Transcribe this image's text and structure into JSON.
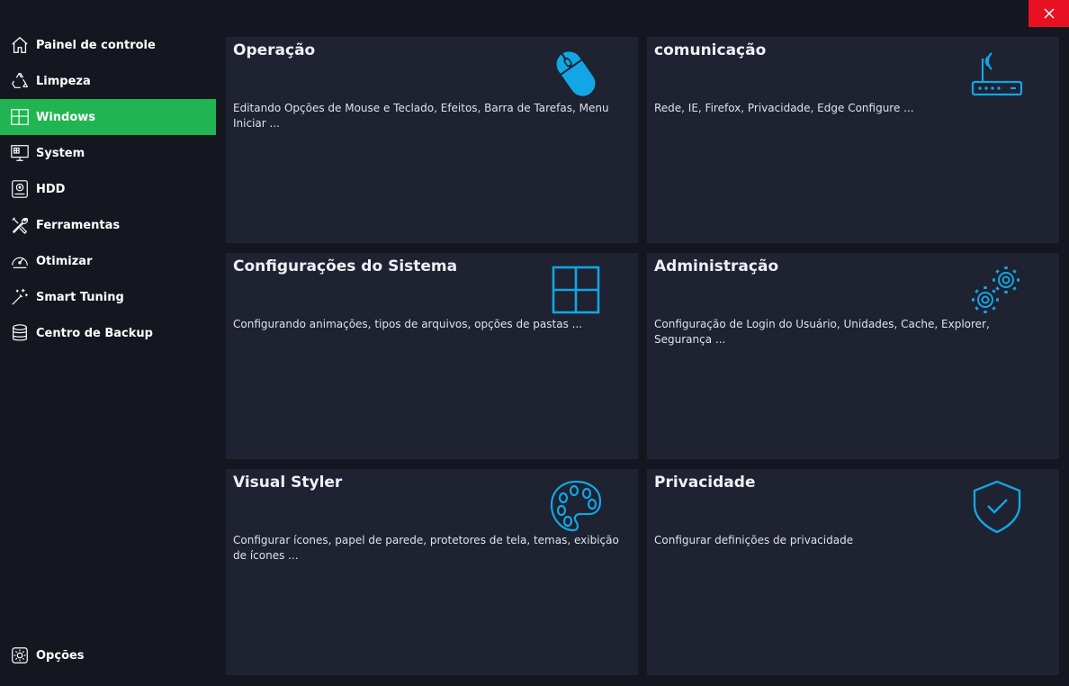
{
  "window": {
    "close_icon": "close-icon"
  },
  "sidebar": {
    "items": [
      {
        "label": "Painel de controle",
        "icon": "home-icon"
      },
      {
        "label": "Limpeza",
        "icon": "recycle-icon"
      },
      {
        "label": "Windows",
        "icon": "windows-icon",
        "active": true
      },
      {
        "label": "System",
        "icon": "monitor-icon"
      },
      {
        "label": "HDD",
        "icon": "hdd-icon"
      },
      {
        "label": "Ferramentas",
        "icon": "tools-icon"
      },
      {
        "label": "Otimizar",
        "icon": "speedometer-icon"
      },
      {
        "label": "Smart Tuning",
        "icon": "magic-wand-icon"
      },
      {
        "label": "Centro de Backup",
        "icon": "database-icon"
      }
    ],
    "options": {
      "label": "Opções",
      "icon": "gear-icon"
    }
  },
  "cards": [
    {
      "title": "Operação",
      "desc": "Editando Opções de Mouse e Teclado, Efeitos, Barra de Tarefas, Menu Iniciar ...",
      "icon": "mouse-icon"
    },
    {
      "title": "comunicação",
      "desc": "Rede, IE, Firefox, Privacidade, Edge Configure ...",
      "icon": "router-icon"
    },
    {
      "title": "Configurações do Sistema",
      "desc": "Configurando animações, tipos de arquivos, opções de pastas ...",
      "icon": "windows-logo-icon"
    },
    {
      "title": "Administração",
      "desc": "Configuração de Login do Usuário, Unidades, Cache, Explorer, Segurança ...",
      "icon": "gears-icon"
    },
    {
      "title": "Visual Styler",
      "desc": "Configurar ícones, papel de parede, protetores de tela, temas, exibição de ícones ...",
      "icon": "palette-icon"
    },
    {
      "title": "Privacidade",
      "desc": "Configurar definições de privacidade",
      "icon": "shield-check-icon"
    }
  ],
  "colors": {
    "background": "#141720",
    "card": "#1e2231",
    "active_nav": "#20b552",
    "accent_icon": "#12a6e4",
    "close": "#e81123"
  }
}
